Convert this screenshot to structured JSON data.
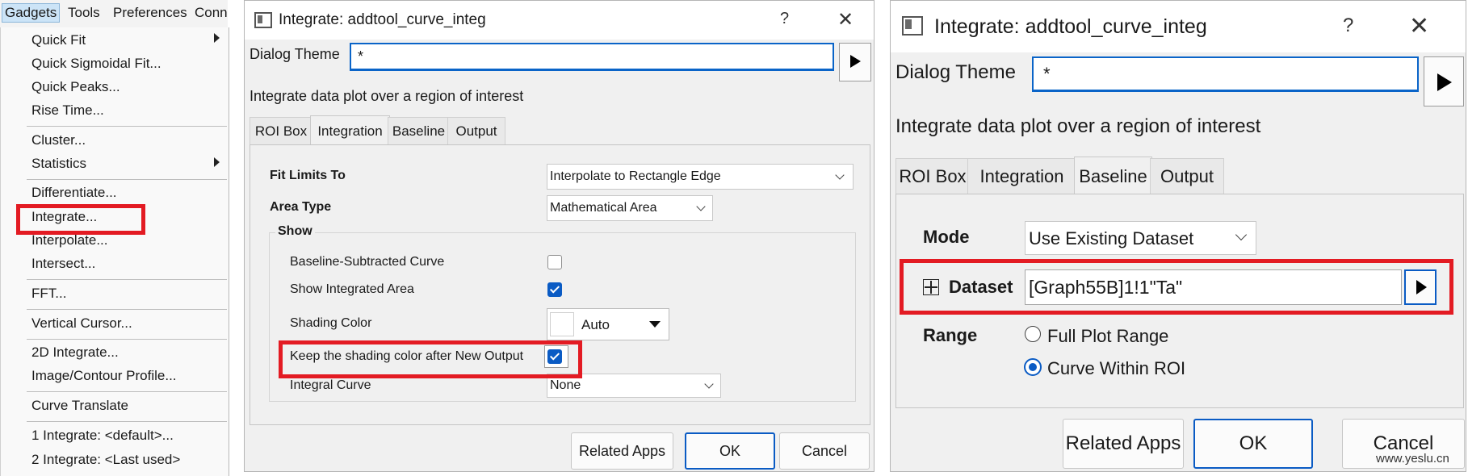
{
  "menubar": {
    "items": [
      "Gadgets",
      "Tools",
      "Preferences",
      "Conn"
    ]
  },
  "gadgets_menu": {
    "items": [
      {
        "label": "Quick Fit"
      },
      {
        "label": "Quick Sigmoidal Fit..."
      },
      {
        "label": "Quick Peaks..."
      },
      {
        "label": "Rise Time..."
      },
      {
        "label": "Cluster..."
      },
      {
        "label": "Statistics"
      },
      {
        "label": "Differentiate..."
      },
      {
        "label": "Integrate..."
      },
      {
        "label": "Interpolate..."
      },
      {
        "label": "Intersect..."
      },
      {
        "label": "FFT..."
      },
      {
        "label": "Vertical Cursor..."
      },
      {
        "label": "2D Integrate..."
      },
      {
        "label": "Image/Contour Profile..."
      },
      {
        "label": "Curve Translate"
      },
      {
        "label": "1 Integrate: <default>..."
      },
      {
        "label": "2 Integrate: <Last used>"
      }
    ]
  },
  "dialog1": {
    "title": "Integrate: addtool_curve_integ",
    "help": "?",
    "close": "✕",
    "theme_label": "Dialog Theme",
    "theme_value": "*",
    "description": "Integrate data plot over a region of interest",
    "tabs": [
      "ROI Box",
      "Integration",
      "Baseline",
      "Output"
    ],
    "fit_limits_label": "Fit Limits To",
    "fit_limits_value": "Interpolate to Rectangle Edge",
    "area_type_label": "Area Type",
    "area_type_value": "Mathematical Area",
    "show_label": "Show",
    "baseline_subtracted_label": "Baseline-Subtracted Curve",
    "baseline_subtracted_checked": false,
    "show_area_label": "Show Integrated Area",
    "show_area_checked": true,
    "shading_color_label": "Shading Color",
    "shading_color_value": "Auto",
    "shading_color_swatch": "#eeeeee",
    "keep_shading_label": "Keep the shading color after New Output",
    "keep_shading_checked": true,
    "integral_curve_label": "Integral Curve",
    "integral_curve_value": "None",
    "btn_related": "Related Apps",
    "btn_ok": "OK",
    "btn_cancel": "Cancel"
  },
  "dialog2": {
    "title": "Integrate: addtool_curve_integ",
    "help": "?",
    "close": "✕",
    "theme_label": "Dialog Theme",
    "theme_value": "*",
    "description": "Integrate data plot over a region of interest",
    "tabs": [
      "ROI Box",
      "Integration",
      "Baseline",
      "Output"
    ],
    "mode_label": "Mode",
    "mode_value": "Use Existing Dataset",
    "dataset_expander": "⊞",
    "dataset_label": "Dataset",
    "dataset_value": "[Graph55B]1!1\"Ta\"",
    "range_label": "Range",
    "range_options": [
      "Full Plot Range",
      "Curve Within ROI"
    ],
    "range_selected": "Curve Within ROI",
    "btn_related": "Related Apps",
    "btn_ok": "OK",
    "btn_cancel": "Cancel"
  },
  "watermark": "www.yeslu.cn",
  "colors": {
    "highlight_red": "#e31b23",
    "accent_blue": "#0a5bc4"
  }
}
